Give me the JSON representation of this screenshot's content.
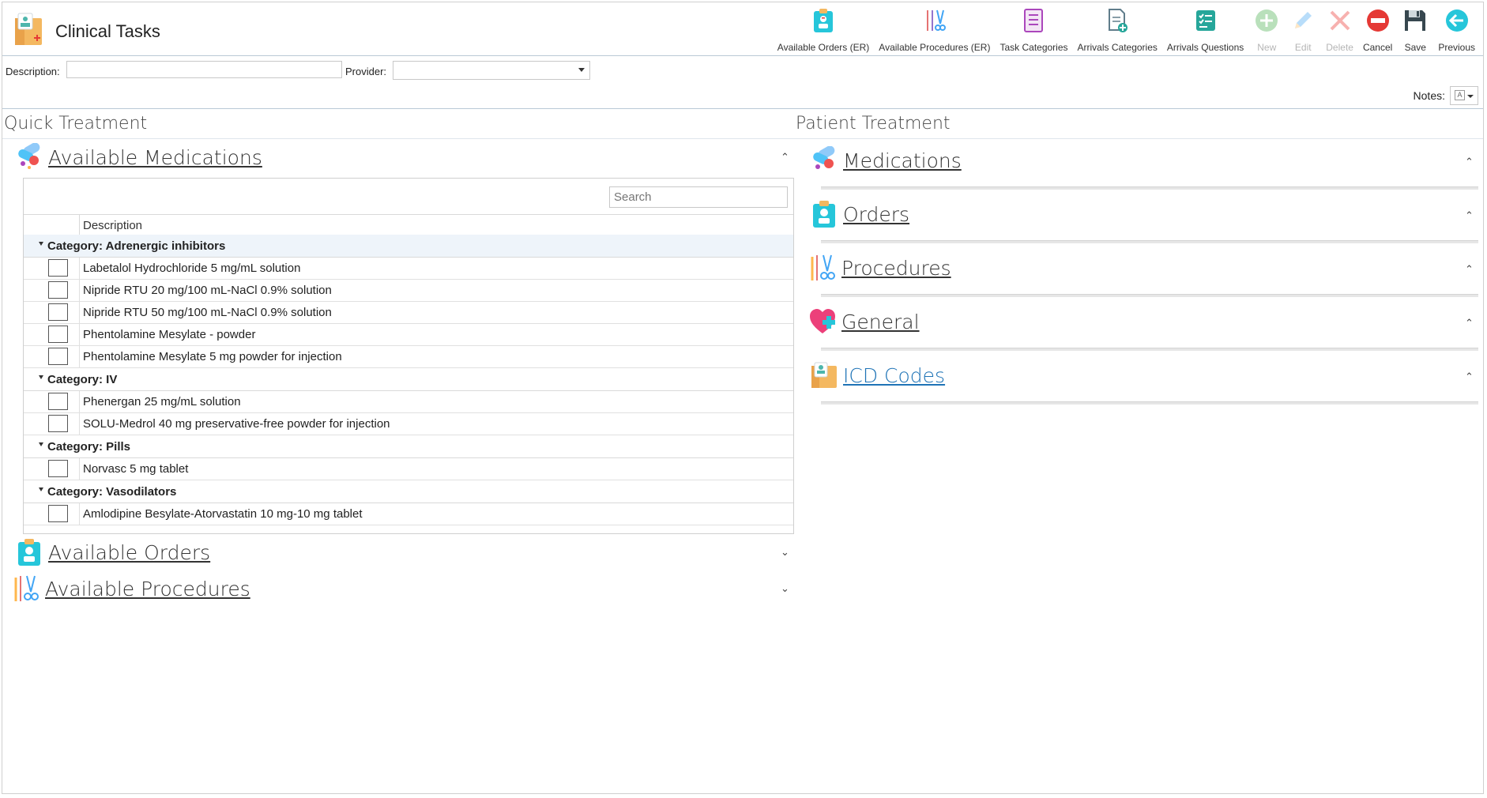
{
  "app": {
    "title": "Clinical Tasks"
  },
  "toolbar": [
    {
      "label": "Available Orders (ER)",
      "icon": "clipboard-icon",
      "enabled": true
    },
    {
      "label": "Available Procedures (ER)",
      "icon": "surgical-tools-icon",
      "enabled": true
    },
    {
      "label": "Task Categories",
      "icon": "checklist-icon",
      "enabled": true
    },
    {
      "label": "Arrivals Categories",
      "icon": "document-add-icon",
      "enabled": true
    },
    {
      "label": "Arrivals Questions",
      "icon": "checklist-add-icon",
      "enabled": true
    },
    {
      "label": "New",
      "icon": "plus-circle-icon",
      "enabled": false
    },
    {
      "label": "Edit",
      "icon": "pencil-icon",
      "enabled": false
    },
    {
      "label": "Delete",
      "icon": "x-icon",
      "enabled": false
    },
    {
      "label": "Cancel",
      "icon": "no-entry-icon",
      "enabled": true
    },
    {
      "label": "Save",
      "icon": "floppy-disk-icon",
      "enabled": true
    },
    {
      "label": "Previous",
      "icon": "arrow-left-circle-icon",
      "enabled": true
    }
  ],
  "filters": {
    "description_label": "Description:",
    "description_value": "",
    "provider_label": "Provider:",
    "provider_value": ""
  },
  "notes": {
    "label": "Notes:"
  },
  "quick_treatment": {
    "title": "Quick Treatment",
    "sections": [
      {
        "title": "Available Medications",
        "expanded": true,
        "icon": "pills-icon"
      },
      {
        "title": "Available Orders",
        "expanded": false,
        "icon": "clipboard-icon"
      },
      {
        "title": "Available Procedures",
        "expanded": false,
        "icon": "surgical-tools-icon"
      }
    ],
    "grid": {
      "search_placeholder": "Search",
      "column_header": "Description",
      "categories": [
        {
          "label": "Category: Adrenergic inhibitors",
          "items": [
            "Labetalol Hydrochloride 5 mg/mL solution",
            "Nipride RTU 20 mg/100 mL-NaCl 0.9% solution",
            "Nipride RTU 50 mg/100 mL-NaCl 0.9% solution",
            "Phentolamine Mesylate - powder",
            "Phentolamine Mesylate 5 mg powder for injection"
          ]
        },
        {
          "label": "Category: IV",
          "items": [
            "Phenergan 25 mg/mL solution",
            "SOLU-Medrol 40 mg preservative-free powder for injection"
          ]
        },
        {
          "label": "Category: Pills",
          "items": [
            "Norvasc 5 mg tablet"
          ]
        },
        {
          "label": "Category: Vasodilators",
          "items": [
            "Amlodipine Besylate-Atorvastatin 10 mg-10 mg tablet"
          ]
        }
      ]
    }
  },
  "patient_treatment": {
    "title": "Patient Treatment",
    "sections": [
      {
        "title": "Medications",
        "icon": "pills-icon"
      },
      {
        "title": "Orders",
        "icon": "clipboard-icon"
      },
      {
        "title": "Procedures",
        "icon": "surgical-tools-icon"
      },
      {
        "title": "General",
        "icon": "heart-plus-icon"
      },
      {
        "title": "ICD Codes",
        "icon": "medical-folder-icon"
      }
    ]
  },
  "colors": {
    "accent": "#1e73b6",
    "divider": "#b9c9d6",
    "category_highlight": "#eef4fa"
  }
}
